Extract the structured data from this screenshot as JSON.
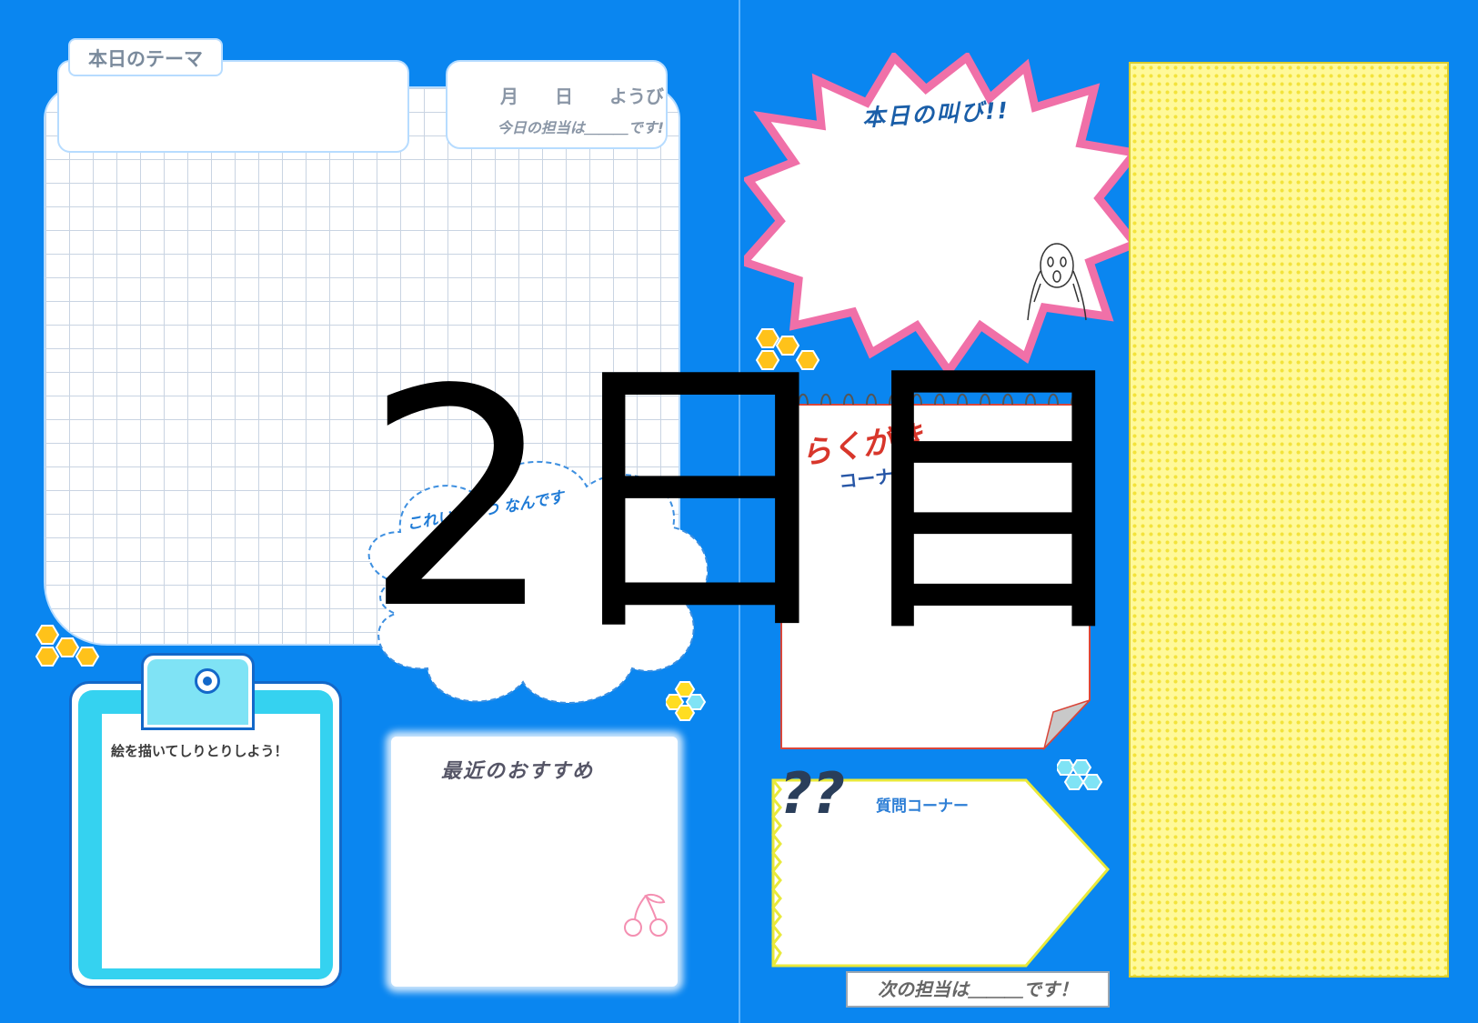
{
  "left_page": {
    "theme_label": "本日のテーマ",
    "date_label": "月　　日　　ようび",
    "duty_label": "今日の担当は＿＿＿です!",
    "cloud_text": "これい　みつ なんです",
    "clipboard_title": "絵を描いてしりとりしよう！",
    "recommend_title": "最近のおすすめ"
  },
  "right_page": {
    "shout_title": "本日の叫び!!",
    "rakugaki_line1": "らくがき",
    "rakugaki_line2": "コーナー",
    "question_title": "質問コーナー",
    "question_marks": "??",
    "next_duty": "次の担当は＿＿＿です！"
  },
  "overlay": {
    "day_text": "2日目"
  },
  "colors": {
    "background": "#0a86f0",
    "burst_border": "#f070a8",
    "yellow_panel": "#fff99a",
    "clipboard_cyan": "#35d2f0",
    "honeycomb": "#ffc21a"
  }
}
